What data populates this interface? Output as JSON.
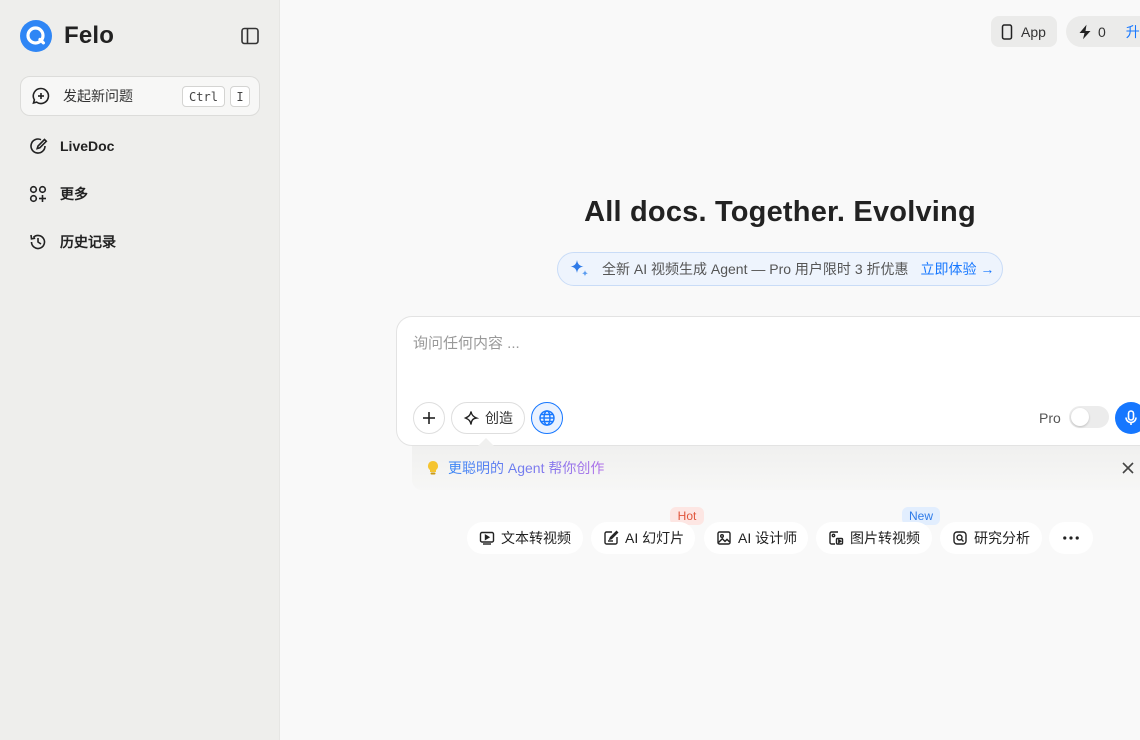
{
  "sidebar": {
    "brand": "Felo",
    "new_question": {
      "label": "发起新问题",
      "shortcut_keys": [
        "Ctrl",
        "I"
      ]
    },
    "items": [
      {
        "id": "livedoc",
        "label": "LiveDoc",
        "icon": "pencil-circle-icon"
      },
      {
        "id": "more",
        "label": "更多",
        "icon": "apps-plus-icon"
      },
      {
        "id": "history",
        "label": "历史记录",
        "icon": "history-icon"
      }
    ]
  },
  "topbar": {
    "app_label": "App",
    "credits": "0",
    "upgrade_label": "升"
  },
  "main": {
    "headline": "All docs. Together. Evolving",
    "promo": {
      "text": "全新 AI 视频生成 Agent — Pro 用户限时 3 折优惠",
      "cta": "立即体验 →"
    },
    "composer": {
      "placeholder": "询问任何内容 ...",
      "create_label": "创造",
      "pro_label": "Pro",
      "pro_enabled": false
    },
    "tip": {
      "text": "更聪明的 Agent 帮你创作"
    },
    "quick_actions": [
      {
        "label": "文本转视频",
        "icon": "video-icon"
      },
      {
        "label": "AI 幻灯片",
        "icon": "slides-edit-icon",
        "badge": "Hot"
      },
      {
        "label": "AI 设计师",
        "icon": "image-icon"
      },
      {
        "label": "图片转视频",
        "icon": "image-to-video-icon",
        "badge": "New"
      },
      {
        "label": "研究分析",
        "icon": "research-icon"
      }
    ]
  },
  "colors": {
    "accent": "#1677ff",
    "sidebar_bg": "#eeeeec",
    "hot": "#e0563c",
    "new": "#2f7be8"
  }
}
